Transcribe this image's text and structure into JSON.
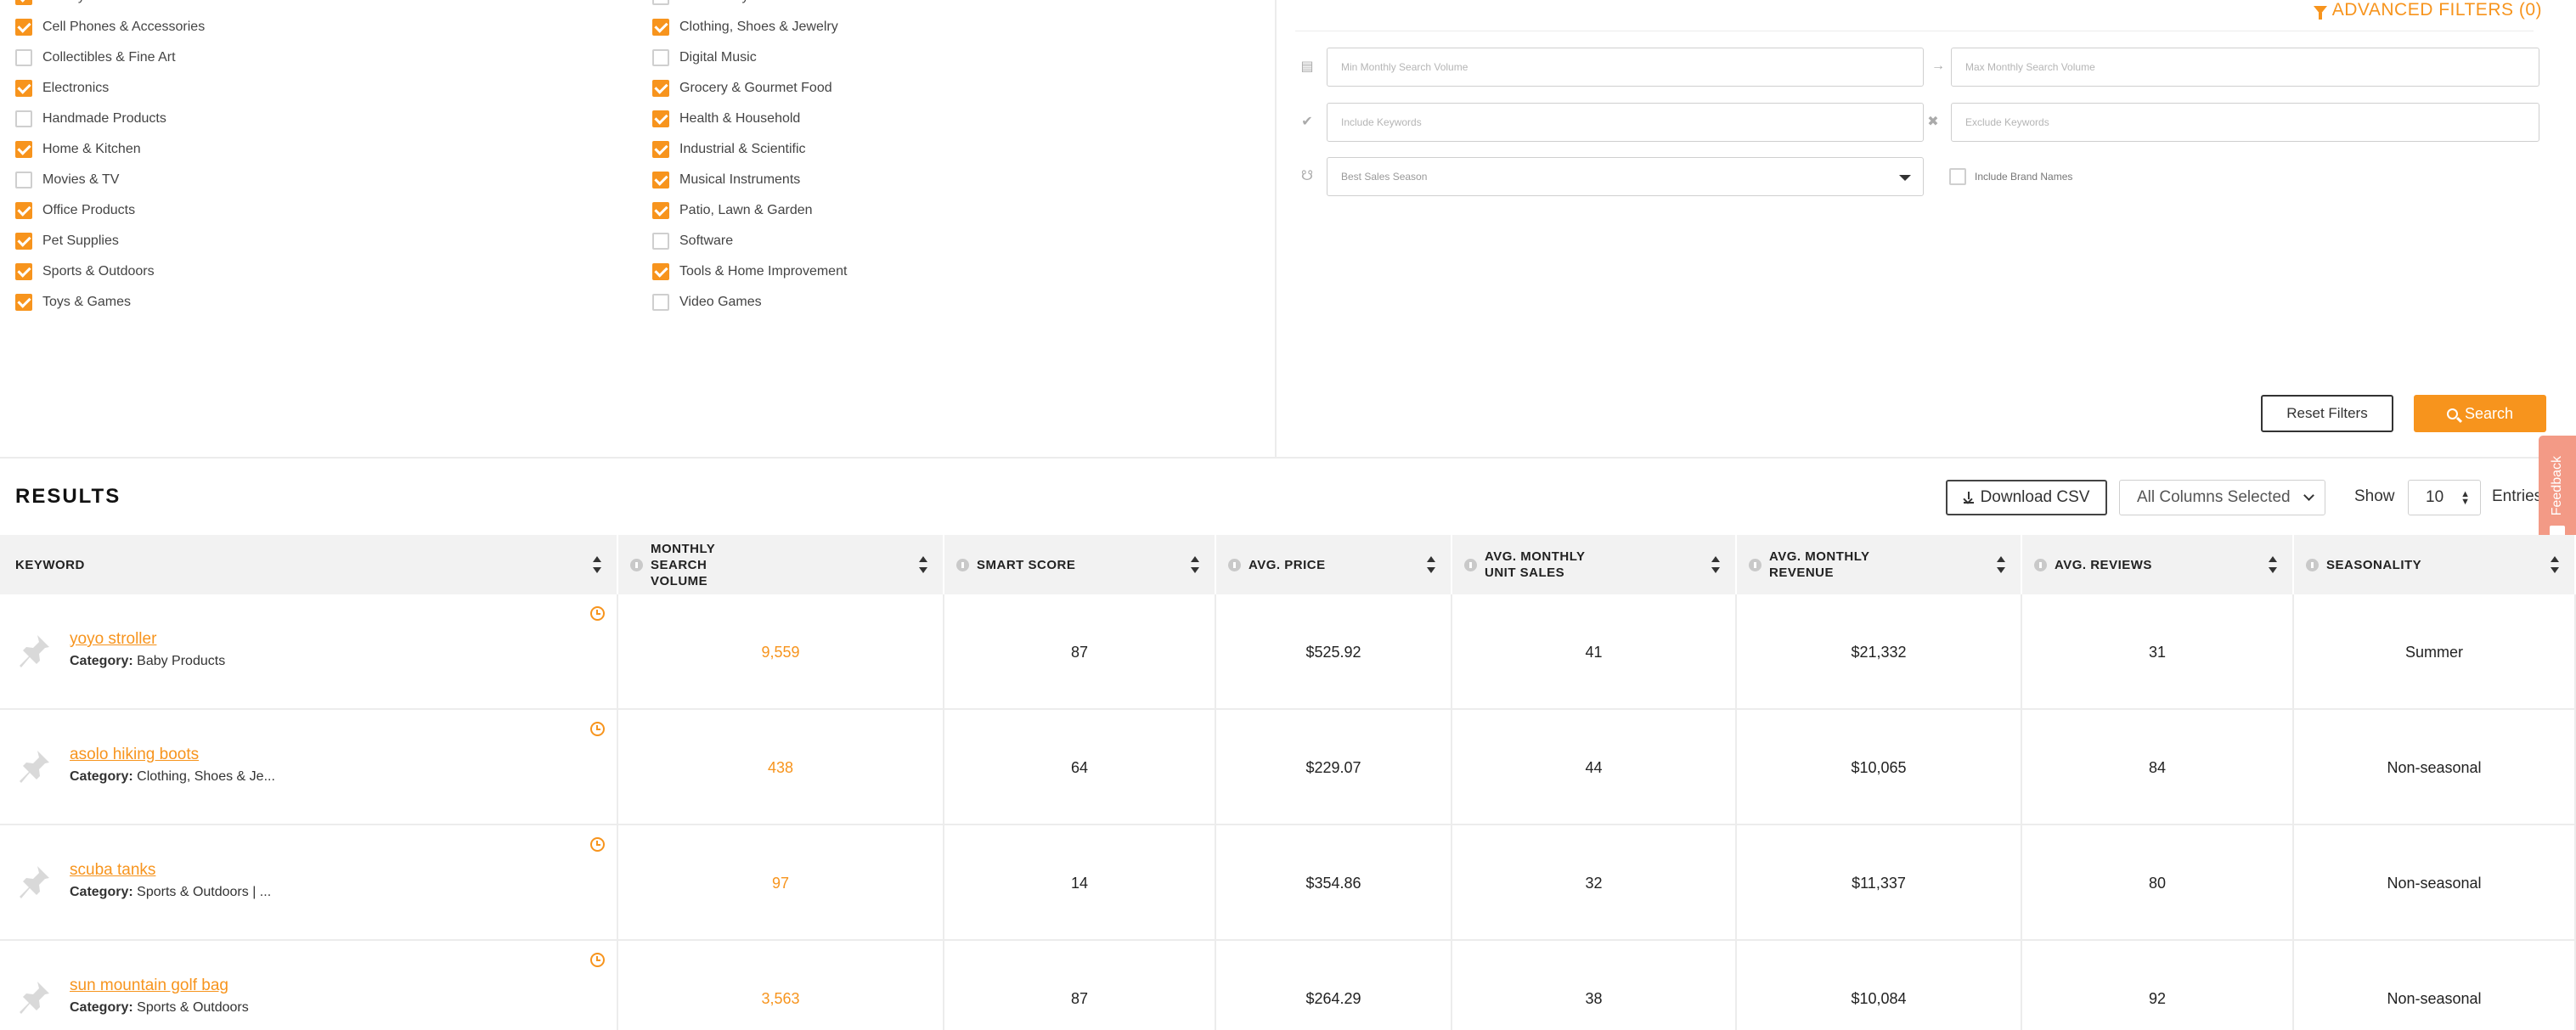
{
  "categories": {
    "left": [
      {
        "label": "Beauty & Personal Care",
        "checked": true
      },
      {
        "label": "Cell Phones & Accessories",
        "checked": true
      },
      {
        "label": "Collectibles & Fine Art",
        "checked": false
      },
      {
        "label": "Electronics",
        "checked": true
      },
      {
        "label": "Handmade Products",
        "checked": false
      },
      {
        "label": "Home & Kitchen",
        "checked": true
      },
      {
        "label": "Movies & TV",
        "checked": false
      },
      {
        "label": "Office Products",
        "checked": true
      },
      {
        "label": "Pet Supplies",
        "checked": true
      },
      {
        "label": "Sports & Outdoors",
        "checked": true
      },
      {
        "label": "Toys & Games",
        "checked": true
      }
    ],
    "right": [
      {
        "label": "CDs & Vinyl",
        "checked": false
      },
      {
        "label": "Clothing, Shoes & Jewelry",
        "checked": true
      },
      {
        "label": "Digital Music",
        "checked": false
      },
      {
        "label": "Grocery & Gourmet Food",
        "checked": true
      },
      {
        "label": "Health & Household",
        "checked": true
      },
      {
        "label": "Industrial & Scientific",
        "checked": true
      },
      {
        "label": "Musical Instruments",
        "checked": true
      },
      {
        "label": "Patio, Lawn & Garden",
        "checked": true
      },
      {
        "label": "Software",
        "checked": false
      },
      {
        "label": "Tools & Home Improvement",
        "checked": true
      },
      {
        "label": "Video Games",
        "checked": false
      }
    ]
  },
  "advanced_filters": {
    "title": "ADVANCED FILTERS (0)",
    "min_volume_placeholder": "Min Monthly Search Volume",
    "max_volume_placeholder": "Max Monthly Search Volume",
    "include_keywords_placeholder": "Include Keywords",
    "exclude_keywords_placeholder": "Exclude Keywords",
    "best_season_placeholder": "Best Sales Season",
    "include_brand_names": "Include Brand Names",
    "reset_label": "Reset Filters",
    "search_label": "Search"
  },
  "results": {
    "title": "RESULTS",
    "download_label": "Download CSV",
    "columns_selected": "All Columns Selected",
    "show_label": "Show",
    "entries_value": "10",
    "entries_label": "Entries"
  },
  "feedback_label": "Feedback",
  "table": {
    "headers": [
      {
        "key": "keyword",
        "label": "KEYWORD",
        "info": false
      },
      {
        "key": "volume",
        "label": "MONTHLY SEARCH VOLUME",
        "info": true
      },
      {
        "key": "smart",
        "label": "SMART SCORE",
        "info": true
      },
      {
        "key": "price",
        "label": "AVG. PRICE",
        "info": true
      },
      {
        "key": "units",
        "label": "AVG. MONTHLY UNIT SALES",
        "info": true
      },
      {
        "key": "revenue",
        "label": "AVG. MONTHLY REVENUE",
        "info": true
      },
      {
        "key": "reviews",
        "label": "AVG. REVIEWS",
        "info": true
      },
      {
        "key": "season",
        "label": "SEASONALITY",
        "info": true
      }
    ],
    "category_prefix": "Category:",
    "rows": [
      {
        "keyword": "yoyo stroller",
        "category": "Baby Products",
        "volume": "9,559",
        "smart": "87",
        "price": "$525.92",
        "units": "41",
        "revenue": "$21,332",
        "reviews": "31",
        "season": "Summer"
      },
      {
        "keyword": "asolo hiking boots",
        "category": "Clothing, Shoes & Je...",
        "volume": "438",
        "smart": "64",
        "price": "$229.07",
        "units": "44",
        "revenue": "$10,065",
        "reviews": "84",
        "season": "Non-seasonal"
      },
      {
        "keyword": "scuba tanks",
        "category": "Sports & Outdoors | ...",
        "volume": "97",
        "smart": "14",
        "price": "$354.86",
        "units": "32",
        "revenue": "$11,337",
        "reviews": "80",
        "season": "Non-seasonal"
      },
      {
        "keyword": "sun mountain golf bag",
        "category": "Sports & Outdoors",
        "volume": "3,563",
        "smart": "87",
        "price": "$264.29",
        "units": "38",
        "revenue": "$10,084",
        "reviews": "92",
        "season": "Non-seasonal"
      }
    ]
  }
}
